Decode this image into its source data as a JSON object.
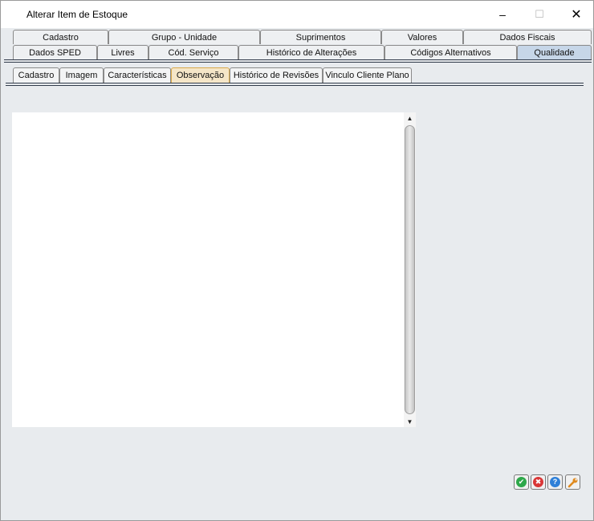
{
  "window": {
    "title": "Alterar Item de Estoque",
    "minimize_glyph": "–",
    "maximize_glyph": "☐",
    "close_glyph": "✕"
  },
  "main_tabs_row1": [
    {
      "label": "Cadastro"
    },
    {
      "label": "Grupo - Unidade"
    },
    {
      "label": "Suprimentos"
    },
    {
      "label": "Valores"
    },
    {
      "label": "Dados Fiscais"
    }
  ],
  "main_tabs_row2": [
    {
      "label": "Dados SPED"
    },
    {
      "label": "Livres"
    },
    {
      "label": "Cód. Serviço"
    },
    {
      "label": "Histórico de Alterações"
    },
    {
      "label": "Códigos Alternativos"
    },
    {
      "label": "Qualidade"
    }
  ],
  "active_main_tab": "Qualidade",
  "sub_tabs": [
    {
      "label": "Cadastro"
    },
    {
      "label": "Imagem"
    },
    {
      "label": "Características"
    },
    {
      "label": "Observação"
    },
    {
      "label": "Histórico de Revisões"
    },
    {
      "label": "Vinculo Cliente Plano"
    }
  ],
  "active_sub_tab": "Observação",
  "observacao": {
    "text": ""
  },
  "scrollbar": {
    "up_glyph": "▲",
    "down_glyph": "▼"
  },
  "actions": {
    "ok_icon": "check-icon",
    "cancel_icon": "cancel-icon",
    "help_icon": "help-icon",
    "tools_icon": "wrench-icon",
    "ok_glyph": "✔",
    "cancel_glyph": "✖",
    "help_glyph": "?",
    "tools_glyph": "🔧"
  },
  "colors": {
    "active_main_tab": "#c6d6e8",
    "active_sub_tab_border": "#d9a94a",
    "ok_green": "#2ea84a",
    "cancel_red": "#d93636",
    "help_blue": "#2f80d8",
    "tools_orange": "#e08a1e"
  }
}
